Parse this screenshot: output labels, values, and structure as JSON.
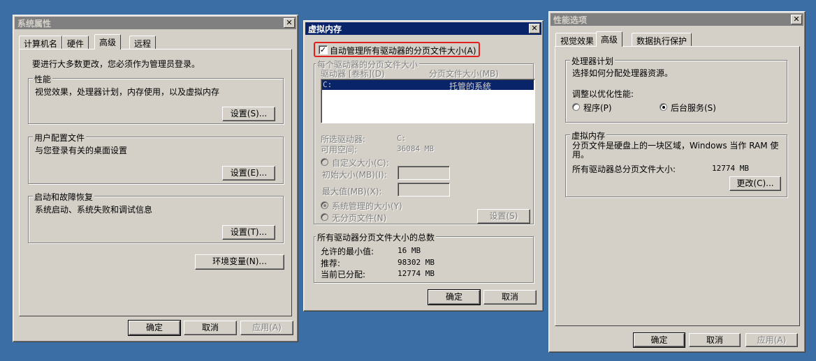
{
  "sysprops": {
    "title": "系统属性",
    "tabs": [
      "计算机名",
      "硬件",
      "高级",
      "远程"
    ],
    "admin_note": "要进行大多数更改，您必须作为管理员登录。",
    "perf": {
      "label": "性能",
      "desc": "视觉效果，处理器计划，内存使用，以及虚拟内存",
      "button": "设置(S)..."
    },
    "profile": {
      "label": "用户配置文件",
      "desc": "与您登录有关的桌面设置",
      "button": "设置(E)..."
    },
    "startup": {
      "label": "启动和故障恢复",
      "desc": "系统启动、系统失败和调试信息",
      "button": "设置(T)..."
    },
    "env_button": "环境变量(N)...",
    "ok": "确定",
    "cancel": "取消",
    "apply": "应用(A)"
  },
  "vmem": {
    "title": "虚拟内存",
    "auto_manage": "自动管理所有驱动器的分页文件大小(A)",
    "auto_checked": "✓",
    "per_drive_label": "每个驱动器的分页文件大小",
    "col_drive": "驱动器 [卷标](D)",
    "col_size": "分页文件大小(MB)",
    "drives": [
      {
        "drive": "C:",
        "size": "托管的系统"
      }
    ],
    "selected_drive_label": "所选驱动器:",
    "selected_drive_value": "C:",
    "free_space_label": "可用空间:",
    "free_space_value": "36084 MB",
    "custom_size": "自定义大小(C):",
    "initial_size": "初始大小(MB)(I):",
    "max_size": "最大值(MB)(X):",
    "system_managed": "系统管理的大小(Y)",
    "no_paging": "无分页文件(N)",
    "set_button": "设置(S)",
    "total_label": "所有驱动器分页文件大小的总数",
    "min_allowed_label": "允许的最小值:",
    "min_allowed_value": "16 MB",
    "recommended_label": "推荐:",
    "recommended_value": "98302 MB",
    "allocated_label": "当前已分配:",
    "allocated_value": "12774 MB",
    "ok": "确定",
    "cancel": "取消",
    "highlight_color": "#e0201c"
  },
  "perfopts": {
    "title": "性能选项",
    "tabs": [
      "视觉效果",
      "高级",
      "数据执行保护"
    ],
    "sched_label": "处理器计划",
    "sched_desc": "选择如何分配处理器资源。",
    "adjust_label": "调整以优化性能:",
    "programs": "程序(P)",
    "background": "后台服务(S)",
    "vm_label": "虚拟内存",
    "vm_desc": "分页文件是硬盘上的一块区域，Windows 当作 RAM 使用。",
    "vm_total_label": "所有驱动器总分页文件大小:",
    "vm_total_value": "12774 MB",
    "change_button": "更改(C)...",
    "ok": "确定",
    "cancel": "取消",
    "apply": "应用(A)"
  }
}
